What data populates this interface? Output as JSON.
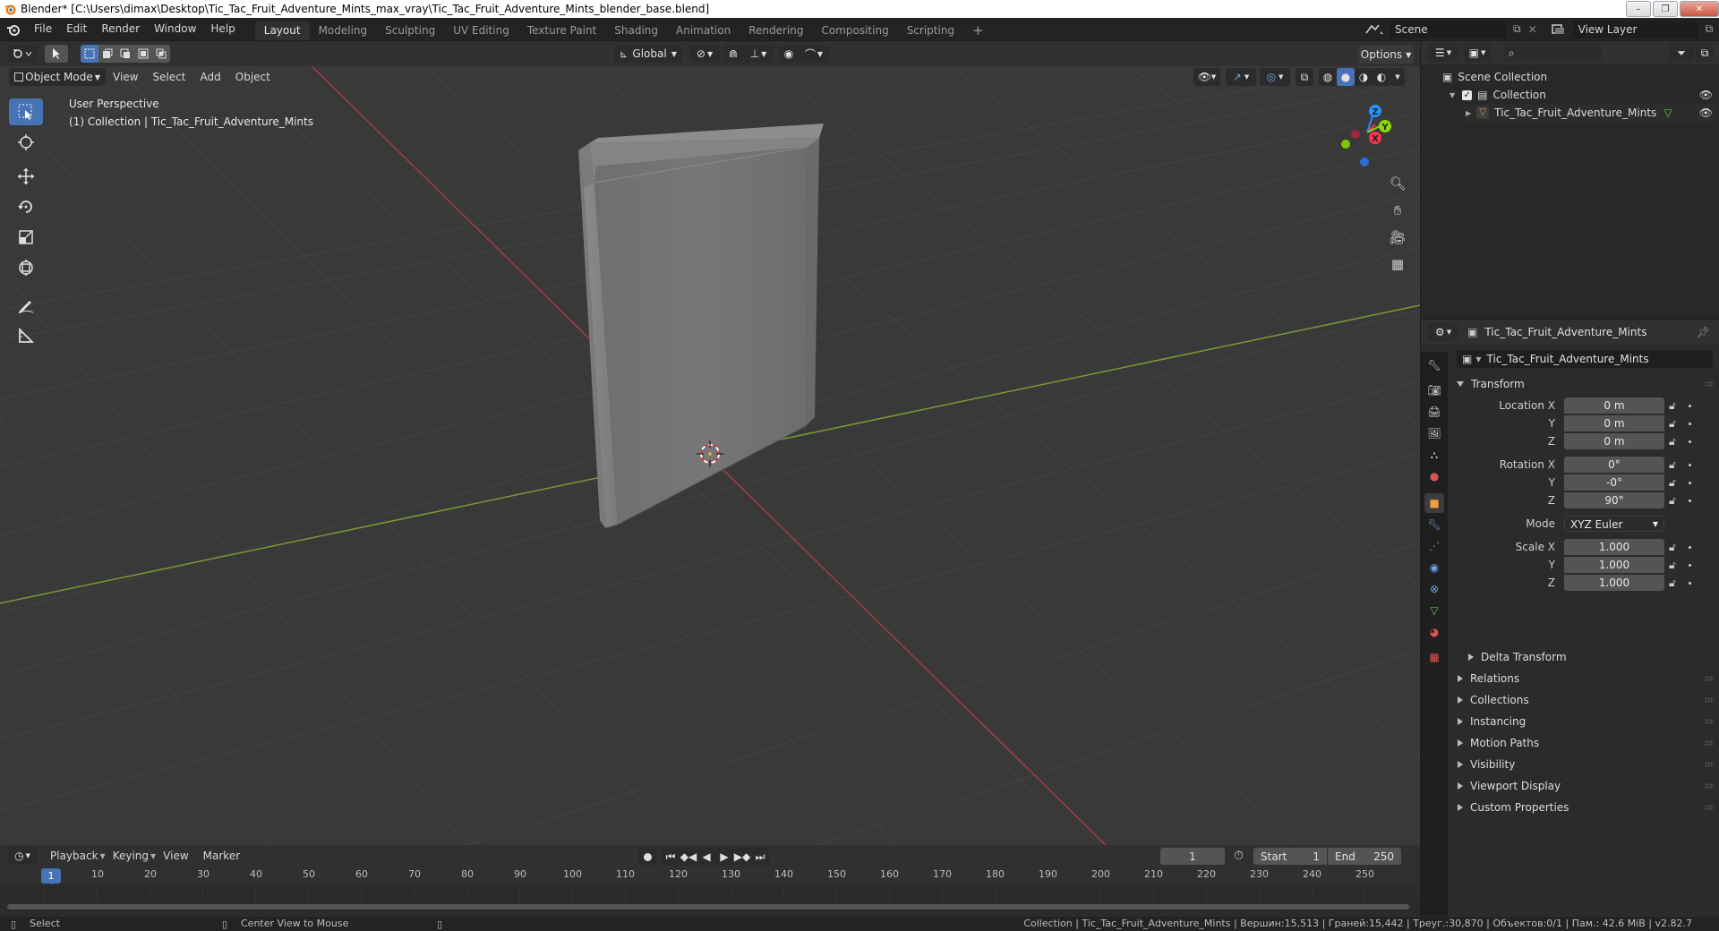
{
  "window": {
    "title": "Blender* [C:\\Users\\dimax\\Desktop\\Tic_Tac_Fruit_Adventure_Mints_max_vray\\Tic_Tac_Fruit_Adventure_Mints_blender_base.blend]"
  },
  "menu": {
    "items": [
      "File",
      "Edit",
      "Render",
      "Window",
      "Help"
    ]
  },
  "workspaces": {
    "tabs": [
      "Layout",
      "Modeling",
      "Sculpting",
      "UV Editing",
      "Texture Paint",
      "Shading",
      "Animation",
      "Rendering",
      "Compositing",
      "Scripting"
    ],
    "add": "+"
  },
  "scene": {
    "name": "Scene",
    "view_layer": "View Layer"
  },
  "viewport": {
    "transform_orientation": "Global",
    "options_label": "Options",
    "mode": "Object Mode",
    "menus": [
      "View",
      "Select",
      "Add",
      "Object"
    ],
    "overlay_line1": "User Perspective",
    "overlay_line2": "(1) Collection | Tic_Tac_Fruit_Adventure_Mints",
    "gizmo": {
      "x": "X",
      "y": "Y",
      "z": "Z"
    }
  },
  "outliner": {
    "root": "Scene Collection",
    "collection": "Collection",
    "object": "Tic_Tac_Fruit_Adventure_Mints"
  },
  "properties": {
    "object_name": "Tic_Tac_Fruit_Adventure_Mints",
    "datablock_name": "Tic_Tac_Fruit_Adventure_Mints",
    "transform_title": "Transform",
    "location": {
      "label_x": "Location X",
      "label_y": "Y",
      "label_z": "Z",
      "x": "0 m",
      "y": "0 m",
      "z": "0 m"
    },
    "rotation": {
      "label_x": "Rotation X",
      "label_y": "Y",
      "label_z": "Z",
      "x": "0°",
      "y": "-0°",
      "z": "90°"
    },
    "mode": {
      "label": "Mode",
      "value": "XYZ Euler"
    },
    "scale": {
      "label_x": "Scale X",
      "label_y": "Y",
      "label_z": "Z",
      "x": "1.000",
      "y": "1.000",
      "z": "1.000"
    },
    "delta_transform": "Delta Transform",
    "panels": [
      "Relations",
      "Collections",
      "Instancing",
      "Motion Paths",
      "Visibility",
      "Viewport Display",
      "Custom Properties"
    ]
  },
  "timeline": {
    "menus": [
      "Playback",
      "Keying",
      "View",
      "Marker"
    ],
    "current_frame": "1",
    "start_label": "Start",
    "start": "1",
    "end_label": "End",
    "end": "250",
    "ruler": [
      "10",
      "20",
      "30",
      "40",
      "50",
      "60",
      "70",
      "80",
      "90",
      "100",
      "110",
      "120",
      "130",
      "140",
      "150",
      "160",
      "170",
      "180",
      "190",
      "200",
      "210",
      "220",
      "230",
      "240",
      "250"
    ],
    "playhead": "1"
  },
  "statusbar": {
    "left": "Select",
    "middle": "Center View to Mouse",
    "right": "Collection | Tic_Tac_Fruit_Adventure_Mints | Вершин:15,513 | Граней:15,442 | Треуг.:30,870 | Объектов:0/1 | Пам.: 42.6 MiB | v2.82.7"
  },
  "colors": {
    "accent": "#4772b3",
    "axis_x": "#ff3352",
    "axis_y": "#8bdc00",
    "axis_z": "#2890ff",
    "object_orange": "#ed9e3f"
  }
}
